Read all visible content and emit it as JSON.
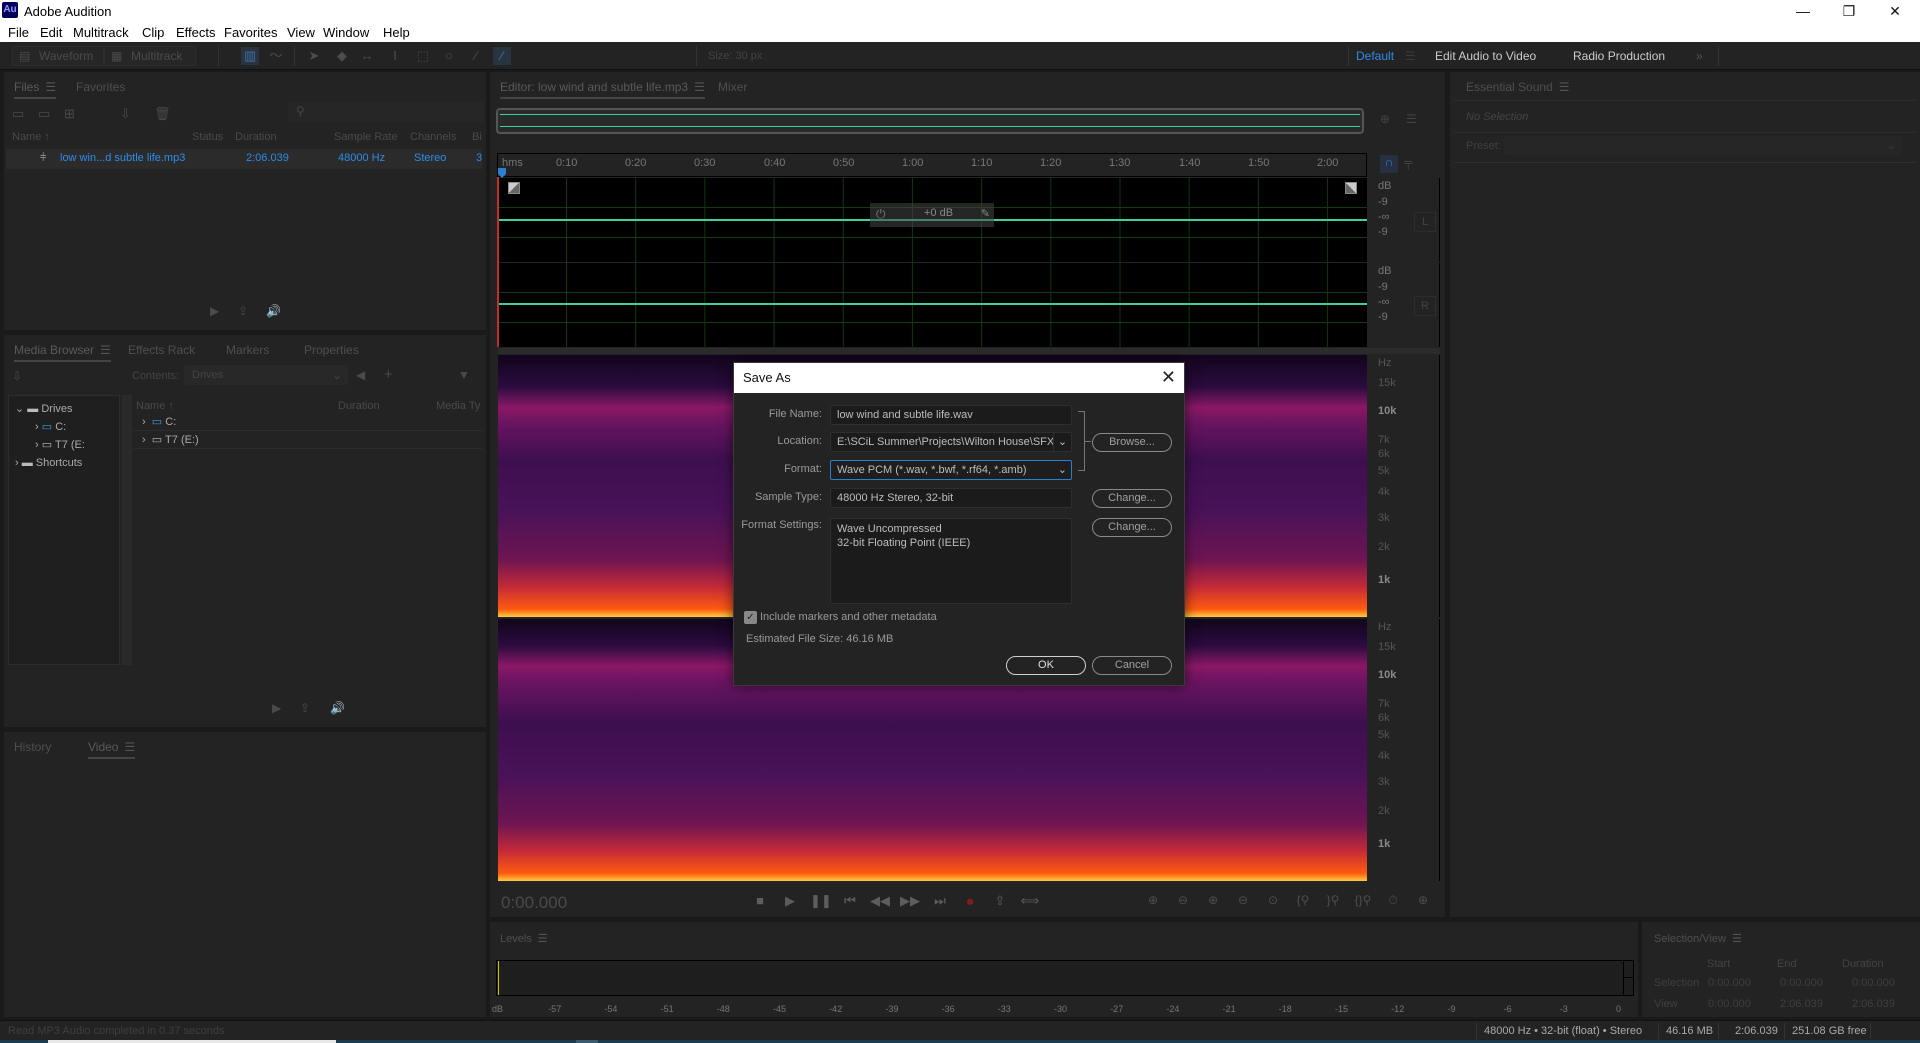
{
  "window": {
    "app_title": "Adobe Audition",
    "logo_text": "Au",
    "controls": {
      "minimize": "—",
      "restore": "❐",
      "close": "✕"
    }
  },
  "menu": [
    "File",
    "Edit",
    "Multitrack",
    "Clip",
    "Effects",
    "Favorites",
    "View",
    "Window",
    "Help"
  ],
  "toolbar": {
    "waveform_label": "Waveform",
    "multitrack_label": "Multitrack",
    "size_label": "Size:  30 px",
    "workspaces": [
      "Default",
      "Edit Audio to Video",
      "Radio Production"
    ],
    "active_workspace": "Default",
    "overflow": "»"
  },
  "files_panel": {
    "tabs": [
      "Files",
      "Favorites"
    ],
    "columns": [
      "Name",
      "Status",
      "Duration",
      "Sample Rate",
      "Channels",
      "Bi"
    ],
    "rows": [
      {
        "name": "low win...d subtle life.mp3",
        "status": "",
        "duration": "2:06.039",
        "sample_rate": "48000 Hz",
        "channels": "Stereo",
        "bits": "3"
      }
    ]
  },
  "media_browser": {
    "tabs": [
      "Media Browser",
      "Effects Rack",
      "Markers",
      "Properties"
    ],
    "contents_label": "Contents:",
    "contents_value": "Drives",
    "tree": [
      {
        "label": "Drives",
        "level": 0
      },
      {
        "label": "C:",
        "level": 1
      },
      {
        "label": "T7 (E:",
        "level": 1
      },
      {
        "label": "Shortcuts",
        "level": 0
      }
    ],
    "columns": [
      "Name",
      "Duration",
      "Media Ty"
    ],
    "rows": [
      "C:",
      "T7 (E:)"
    ]
  },
  "history_panel": {
    "tabs": [
      "History",
      "Video"
    ]
  },
  "editor": {
    "tabs": [
      "Editor: low wind and subtle life.mp3",
      "Mixer"
    ],
    "ruler_unit": "hms",
    "ruler_ticks": [
      "0:10",
      "0:20",
      "0:30",
      "0:40",
      "0:50",
      "1:00",
      "1:10",
      "1:20",
      "1:30",
      "1:40",
      "1:50",
      "2:00"
    ],
    "db_scale": [
      "dB",
      "-9",
      "-∞",
      "-9"
    ],
    "channels": [
      "L",
      "R"
    ],
    "hud_gain": "+0 dB",
    "hz_scale": [
      "Hz",
      "15k",
      "10k",
      "7k",
      "6k",
      "5k",
      "4k",
      "3k",
      "2k",
      "1k"
    ],
    "current_time": "0:00.000",
    "colors": {
      "waveform": "#3fd09a",
      "playhead": "#2d7fd1",
      "record": "#7a1e1e"
    }
  },
  "essential_sound": {
    "title": "Essential Sound",
    "no_selection": "No Selection",
    "preset_label": "Preset:"
  },
  "save_as_dialog": {
    "title": "Save As",
    "file_name_label": "File Name:",
    "file_name_value": "low wind and subtle life.wav",
    "location_label": "Location:",
    "location_value": "E:\\SCiL Summer\\Projects\\Wilton House\\SFX",
    "format_label": "Format:",
    "format_value": "Wave PCM (*.wav, *.bwf, *.rf64, *.amb)",
    "sample_type_label": "Sample Type:",
    "sample_type_value": "48000 Hz Stereo, 32-bit",
    "format_settings_label": "Format Settings:",
    "format_settings_lines": [
      "Wave Uncompressed",
      "32-bit Floating Point (IEEE)"
    ],
    "browse_button": "Browse...",
    "change_button_1": "Change...",
    "change_button_2": "Change...",
    "include_markers_label": "Include markers and other metadata",
    "include_markers_checked": true,
    "estimated_size": "Estimated File Size: 46.16 MB",
    "ok_button": "OK",
    "cancel_button": "Cancel"
  },
  "levels": {
    "title": "Levels",
    "ticks": [
      "dB",
      "-57",
      "-54",
      "-51",
      "-48",
      "-45",
      "-42",
      "-39",
      "-36",
      "-33",
      "-30",
      "-27",
      "-24",
      "-21",
      "-18",
      "-15",
      "-12",
      "-9",
      "-6",
      "-3",
      "0"
    ]
  },
  "selection_view": {
    "title": "Selection/View",
    "headers": [
      "Start",
      "End",
      "Duration"
    ],
    "rows": [
      {
        "label": "Selection",
        "start": "0:00.000",
        "end": "0:00.000",
        "duration": "0:00.000"
      },
      {
        "label": "View",
        "start": "0:00.000",
        "end": "2:06.039",
        "duration": "2:06.039"
      }
    ]
  },
  "status_bar": {
    "message": "Read MP3 Audio completed in 0.37 seconds",
    "format": "48000 Hz • 32-bit (float) • Stereo",
    "size": "46.16 MB",
    "duration": "2:06.039",
    "free": "251.08 GB free"
  }
}
